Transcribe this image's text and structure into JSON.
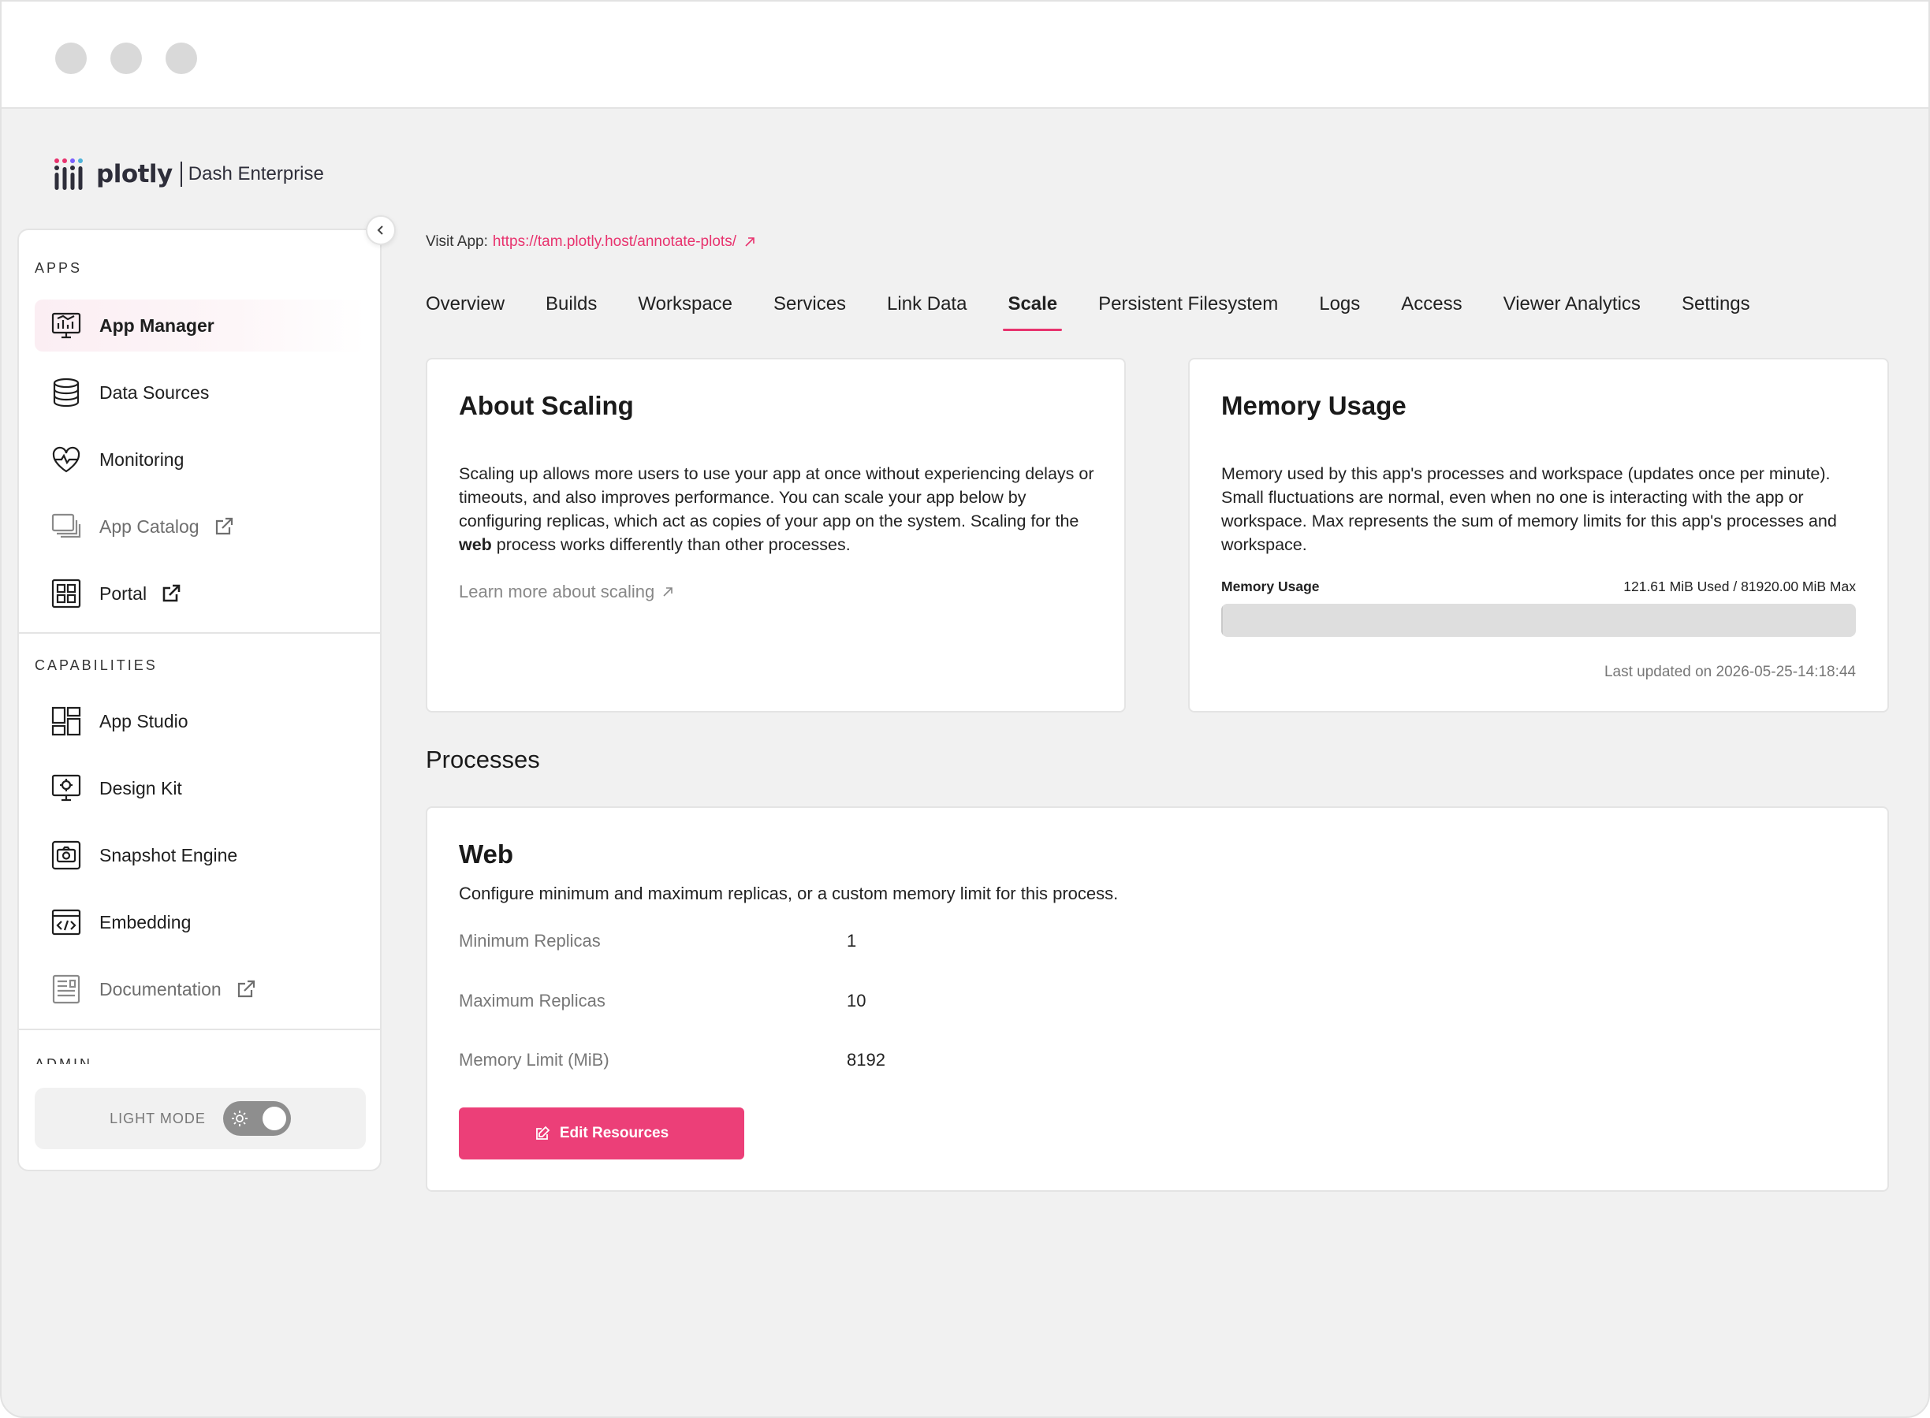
{
  "brand": {
    "word": "plotly",
    "product": "Dash Enterprise"
  },
  "sidebar": {
    "apps_label": "APPS",
    "capabilities_label": "CAPABILITIES",
    "admin_label": "ADMIN",
    "apps": [
      {
        "label": "App Manager",
        "icon": "monitor-chart-icon",
        "active": true
      },
      {
        "label": "Data Sources",
        "icon": "database-icon"
      },
      {
        "label": "Monitoring",
        "icon": "heart-pulse-icon"
      },
      {
        "label": "App Catalog",
        "icon": "catalog-icon",
        "external": true
      },
      {
        "label": "Portal",
        "icon": "portal-grid-icon",
        "external": true
      }
    ],
    "capabilities": [
      {
        "label": "App Studio",
        "icon": "layout-icon"
      },
      {
        "label": "Design Kit",
        "icon": "design-monitor-icon"
      },
      {
        "label": "Snapshot Engine",
        "icon": "camera-icon"
      },
      {
        "label": "Embedding",
        "icon": "code-window-icon"
      },
      {
        "label": "Documentation",
        "icon": "document-icon",
        "external": true
      }
    ],
    "mode_label": "LIGHT MODE"
  },
  "visit": {
    "label": "Visit App:",
    "url": "https://tam.plotly.host/annotate-plots/"
  },
  "tabs": [
    "Overview",
    "Builds",
    "Workspace",
    "Services",
    "Link Data",
    "Scale",
    "Persistent Filesystem",
    "Logs",
    "Access",
    "Viewer Analytics",
    "Settings"
  ],
  "active_tab": "Scale",
  "about": {
    "title": "About Scaling",
    "text_before": "Scaling up allows more users to use your app at once without experiencing delays or timeouts, and also improves performance. You can scale your app below by configuring replicas, which act as copies of your app on the system. Scaling for the ",
    "text_bold": "web",
    "text_after": " process works differently than other processes.",
    "learn_more": "Learn more about scaling"
  },
  "memory": {
    "title": "Memory Usage",
    "text": "Memory used by this app's processes and workspace (updates once per minute). Small fluctuations are normal, even when no one is interacting with the app or workspace. Max represents the sum of memory limits for this app's processes and workspace.",
    "bar_label": "Memory Usage",
    "usage_text": "121.61 MiB Used / 81920.00 MiB Max",
    "used_fraction": 0.0015,
    "updated": "Last updated on 2026-05-25-14:18:44"
  },
  "processes": {
    "title": "Processes",
    "web": {
      "title": "Web",
      "description": "Configure minimum and maximum replicas, or a custom memory limit for this process.",
      "rows": [
        {
          "label": "Minimum Replicas",
          "value": "1"
        },
        {
          "label": "Maximum Replicas",
          "value": "10"
        },
        {
          "label": "Memory Limit (MiB)",
          "value": "8192"
        }
      ],
      "button": "Edit Resources"
    }
  },
  "colors": {
    "accent": "#e8336e",
    "button": "#ec3f78"
  }
}
